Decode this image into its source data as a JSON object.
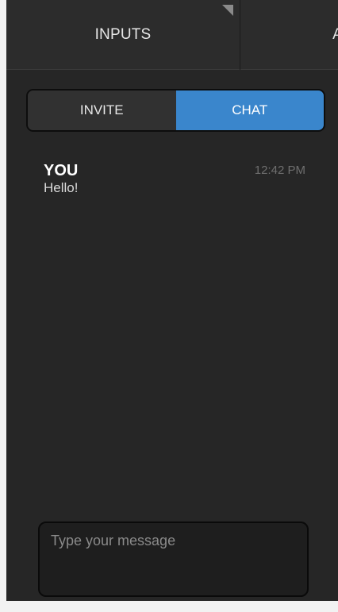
{
  "tabs": {
    "inputs_label": "INPUTS",
    "next_label": "A"
  },
  "segmented": {
    "invite_label": "INVITE",
    "chat_label": "CHAT",
    "active": "CHAT"
  },
  "messages": [
    {
      "sender": "YOU",
      "time": "12:42 PM",
      "text": "Hello!"
    }
  ],
  "composer": {
    "placeholder": "Type your message",
    "value": ""
  },
  "colors": {
    "accent": "#3a86cc",
    "background": "#262626"
  }
}
